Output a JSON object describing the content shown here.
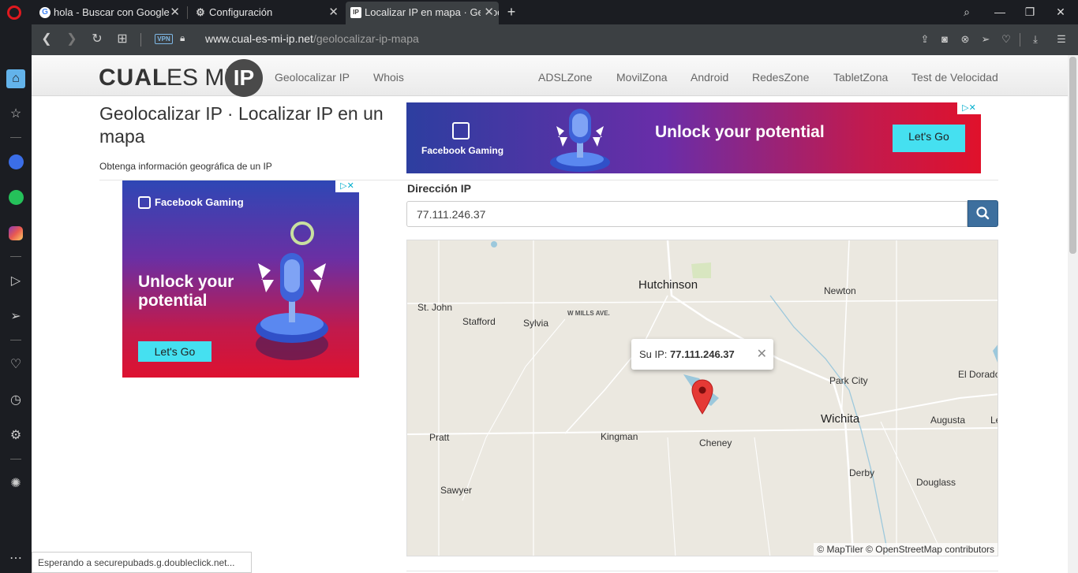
{
  "browser": {
    "tabs": [
      {
        "title": "hola - Buscar con Google"
      },
      {
        "title": "Configuración"
      },
      {
        "title": "Localizar IP en mapa · Geolocalizar IP"
      }
    ],
    "url_domain": "www.cual-es-mi-ip.net",
    "url_path": "/geolocalizar-ip-mapa",
    "vpn_badge": "VPN",
    "status_text": "Esperando a securepubads.g.doubleclick.net..."
  },
  "site": {
    "logo_bold": "CUAL",
    "logo_light": "ES MI",
    "logo_ip": "IP",
    "menu_left": [
      "Geolocalizar IP",
      "Whois"
    ],
    "menu_right": [
      "ADSLZone",
      "MovilZona",
      "Android",
      "RedesZone",
      "TabletZona",
      "Test de Velocidad"
    ]
  },
  "main": {
    "title": "Geolocalizar IP · Localizar IP en un mapa",
    "subtitle": "Obtenga información geográfica de un IP",
    "ip_label": "Dirección IP",
    "ip_value": "77.111.246.37"
  },
  "ads": {
    "brand": "Facebook Gaming",
    "headline": "Unlock your potential",
    "cta": "Let's Go"
  },
  "map": {
    "popup_label": "Su IP:",
    "popup_ip": "77.111.246.37",
    "attribution": "© MapTiler © OpenStreetMap contributors",
    "cities": {
      "hutchinson": "Hutchinson",
      "newton": "Newton",
      "stjohn": "St. John",
      "stafford": "Stafford",
      "sylvia": "Sylvia",
      "wmills": "W MILLS AVE.",
      "parkcity": "Park City",
      "eldorado": "El Dorado",
      "wichita": "Wichita",
      "augusta": "Augusta",
      "le": "Le",
      "pratt": "Pratt",
      "kingman": "Kingman",
      "cheney": "Cheney",
      "derby": "Derby",
      "douglass": "Douglass",
      "sawyer": "Sawyer"
    }
  }
}
